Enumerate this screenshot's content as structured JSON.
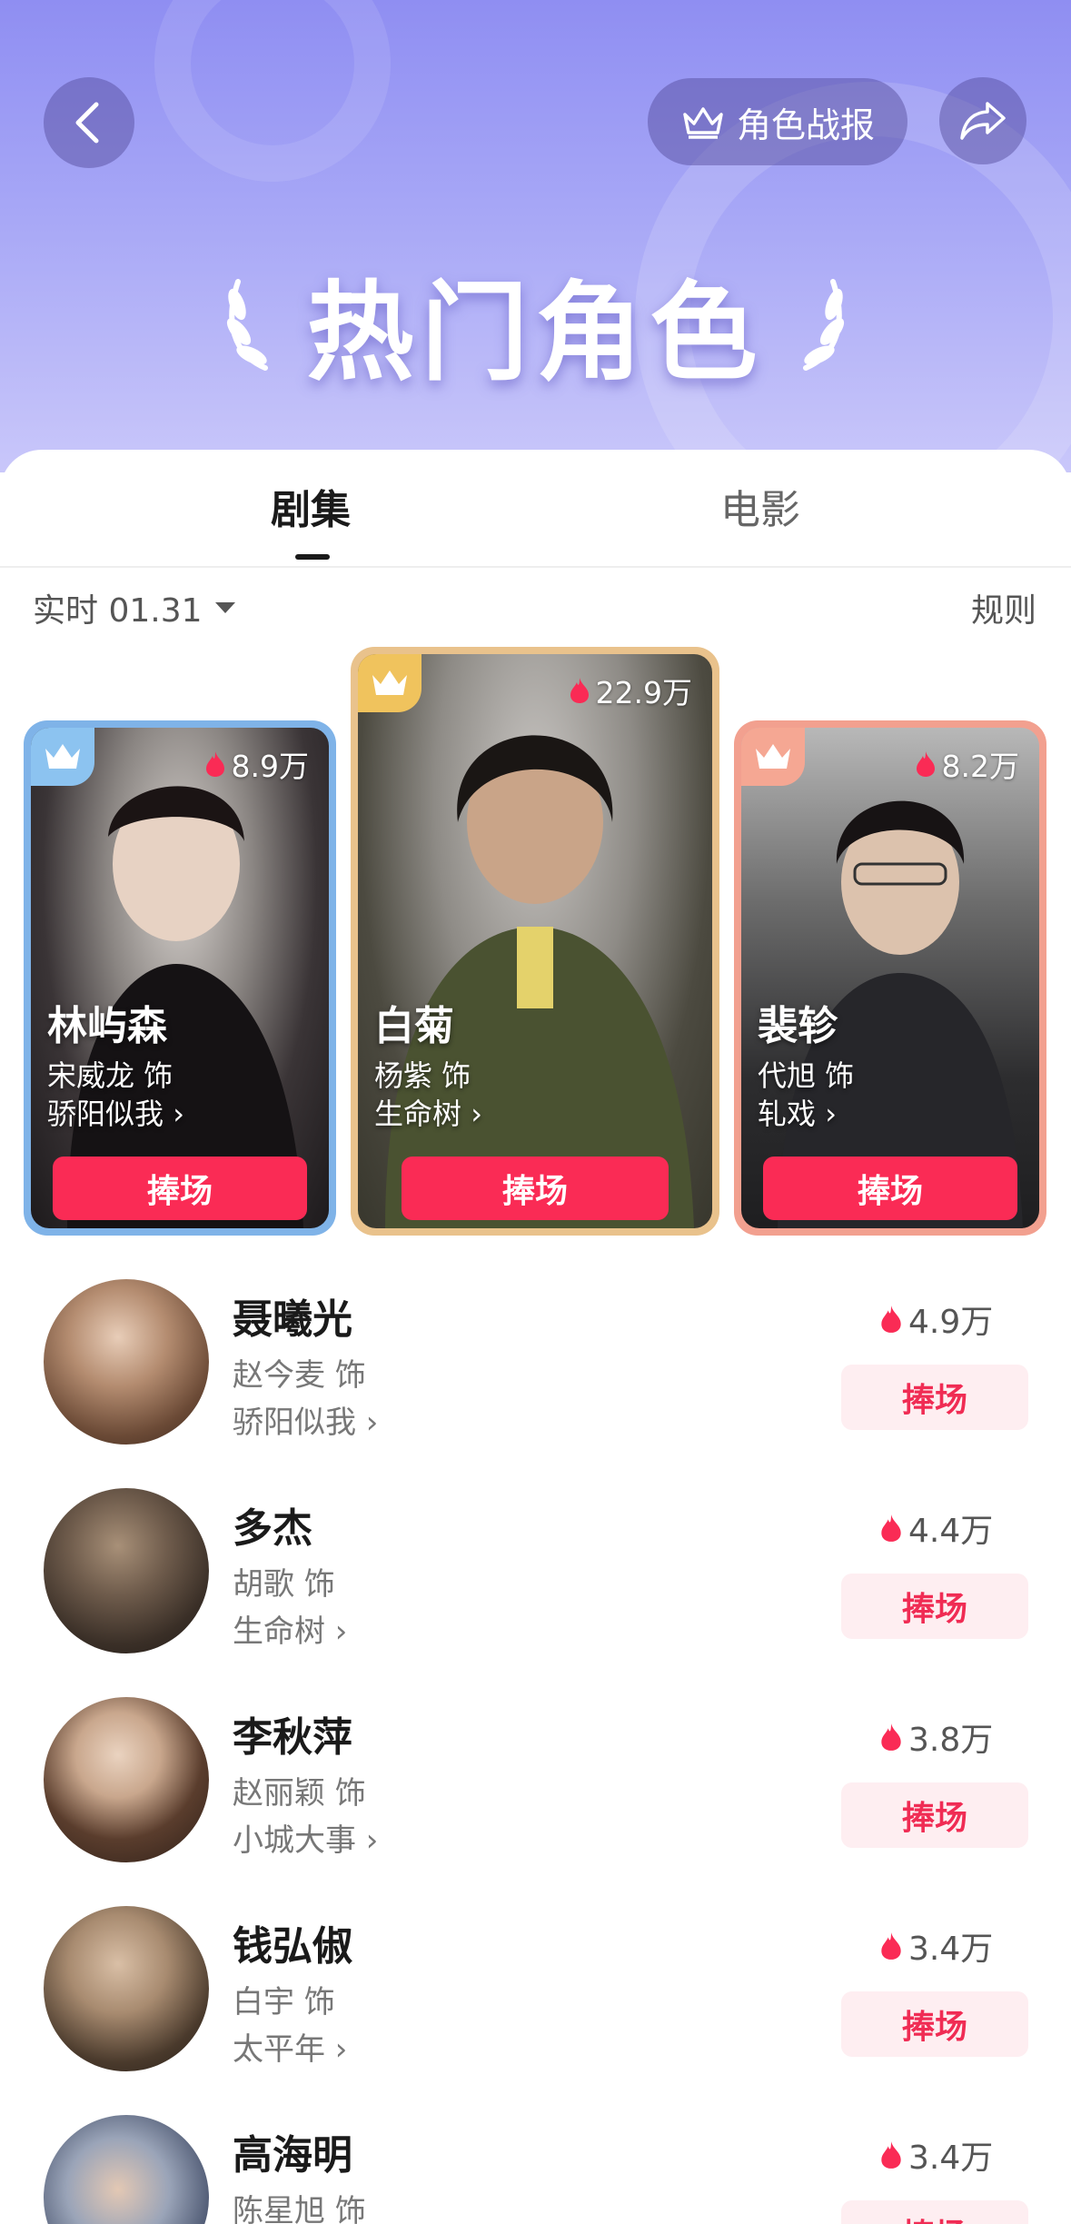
{
  "header": {
    "title": "热门角色",
    "report_label": "角色战报"
  },
  "tabs": [
    {
      "label": "剧集",
      "active": true
    },
    {
      "label": "电影",
      "active": false
    }
  ],
  "filter": {
    "date_label": "实时 01.31",
    "rules_label": "规则"
  },
  "top_three": [
    {
      "rank": 2,
      "name": "林屿森",
      "actor": "宋威龙 饰",
      "drama": "骄阳似我",
      "heat": "8.9万",
      "cheer_label": "捧场",
      "border_color": "#7fb3e8",
      "crown_color": "#8cc3f0"
    },
    {
      "rank": 1,
      "name": "白菊",
      "actor": "杨紫 饰",
      "drama": "生命树",
      "heat": "22.9万",
      "cheer_label": "捧场",
      "border_color": "#e9c28c",
      "crown_color": "#f0c35d"
    },
    {
      "rank": 3,
      "name": "裴轸",
      "actor": "代旭 饰",
      "drama": "轧戏",
      "heat": "8.2万",
      "cheer_label": "捧场",
      "border_color": "#f2a08f",
      "crown_color": "#f5a793"
    }
  ],
  "list": [
    {
      "name": "聂曦光",
      "actor": "赵今麦 饰",
      "drama": "骄阳似我",
      "heat": "4.9万",
      "cheer_label": "捧场"
    },
    {
      "name": "多杰",
      "actor": "胡歌 饰",
      "drama": "生命树",
      "heat": "4.4万",
      "cheer_label": "捧场"
    },
    {
      "name": "李秋萍",
      "actor": "赵丽颖 饰",
      "drama": "小城大事",
      "heat": "3.8万",
      "cheer_label": "捧场"
    },
    {
      "name": "钱弘俶",
      "actor": "白宇 饰",
      "drama": "太平年",
      "heat": "3.4万",
      "cheer_label": "捧场"
    },
    {
      "name": "高海明",
      "actor": "陈星旭 饰",
      "drama": "",
      "heat": "3.4万",
      "cheer_label": "捧场"
    }
  ],
  "colors": {
    "accent": "#fa2b55",
    "cheer_soft_bg": "#feeef1",
    "header_gradient_top": "#8f8ef2"
  },
  "icons": {
    "back": "chevron-left-icon",
    "crown": "crown-icon",
    "share": "share-icon",
    "flame": "flame-icon",
    "dropdown": "triangle-down-icon",
    "chevron": "chevron-right-icon"
  }
}
